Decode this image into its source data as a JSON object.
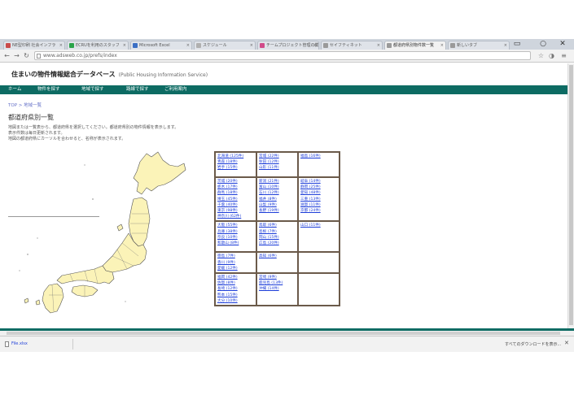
{
  "browser": {
    "tabs": [
      {
        "label": "NE型印刷 社会インフラ",
        "fav": "#c94b4b"
      },
      {
        "label": "ECRUを利用のスタッフ",
        "fav": "#2aa44a"
      },
      {
        "label": "Microsoft Excel",
        "fav": "#3b6fc4"
      },
      {
        "label": "スケジュール",
        "fav": "#b0b0b0"
      },
      {
        "label": "チームプロジェクト管理の業",
        "fav": "#d14b8a"
      },
      {
        "label": "セイフティネット",
        "fav": "#9a9a9a"
      },
      {
        "label": "都道府県別物件数一覧",
        "fav": "#9a9a9a",
        "active": true
      },
      {
        "label": "新しいタブ",
        "fav": "#9a9a9a"
      }
    ],
    "url": "www.adsweb.co.jp/prefs/index"
  },
  "site": {
    "title": "住まいの物件情報総合データベース",
    "subtitle": "(Public Housing Information Service)"
  },
  "nav": [
    "ホーム",
    "物件を探す",
    "地域で探す",
    "路線で探す",
    "ご利用案内"
  ],
  "breadcrumb": "TOP > 地域一覧",
  "heading": "都道府県別一覧",
  "desc": [
    "地図または一覧表から、都道府県を選択してください。都道府県別の物件情報を表示します。",
    "表示件数は毎日更新されます。",
    "地図の都道府県にカーソルを合わせると、名称が表示されます。"
  ],
  "prefectures": [
    {
      "cells": [
        [
          "北海道 (125件)",
          "青森 (18件)",
          "岩手 (15件)"
        ],
        [
          "宮城 (22件)",
          "秋田 (12件)",
          "山形 (11件)"
        ],
        [
          "福島 (16件)",
          "",
          ""
        ]
      ]
    },
    {
      "cells": [
        [
          "茨城 (20件)",
          "栃木 (17件)",
          "群馬 (18件)",
          "埼玉 (45件)",
          "千葉 (40件)",
          "東京 (98件)",
          "神奈川 (62件)"
        ],
        [
          "新潟 (21件)",
          "富山 (10件)",
          "石川 (12件)",
          "福井 (8件)",
          "山梨 (9件)",
          "長野 (19件)"
        ],
        [
          "岐阜 (14件)",
          "静岡 (25件)",
          "愛知 (48件)",
          "三重 (13件)",
          "滋賀 (11件)",
          "京都 (24件)"
        ]
      ]
    },
    {
      "cells": [
        [
          "大阪 (55件)",
          "兵庫 (38件)",
          "奈良 (10件)",
          "和歌山 (8件)"
        ],
        [
          "鳥取 (6件)",
          "島根 (7件)",
          "岡山 (15件)",
          "広島 (20件)"
        ],
        [
          "山口 (11件)",
          "",
          ""
        ]
      ]
    },
    {
      "cells": [
        [
          "徳島 (7件)",
          "香川 (9件)",
          "愛媛 (12件)"
        ],
        [
          "高知 (6件)",
          "",
          ""
        ],
        [
          "",
          "",
          ""
        ]
      ]
    },
    {
      "cells": [
        [
          "福岡 (42件)",
          "佐賀 (8件)",
          "長崎 (12件)",
          "熊本 (15件)",
          "大分 (10件)"
        ],
        [
          "宮崎 (9件)",
          "鹿児島 (13件)",
          "沖縄 (14件)"
        ],
        [
          "",
          "",
          ""
        ]
      ]
    }
  ],
  "download": {
    "label": "File.xlsx"
  },
  "download_all": "すべてのダウンロードを表示...",
  "colors": {
    "accent": "#0d6b63",
    "map_fill": "#fbf3b8",
    "link": "#1f3fd9"
  }
}
